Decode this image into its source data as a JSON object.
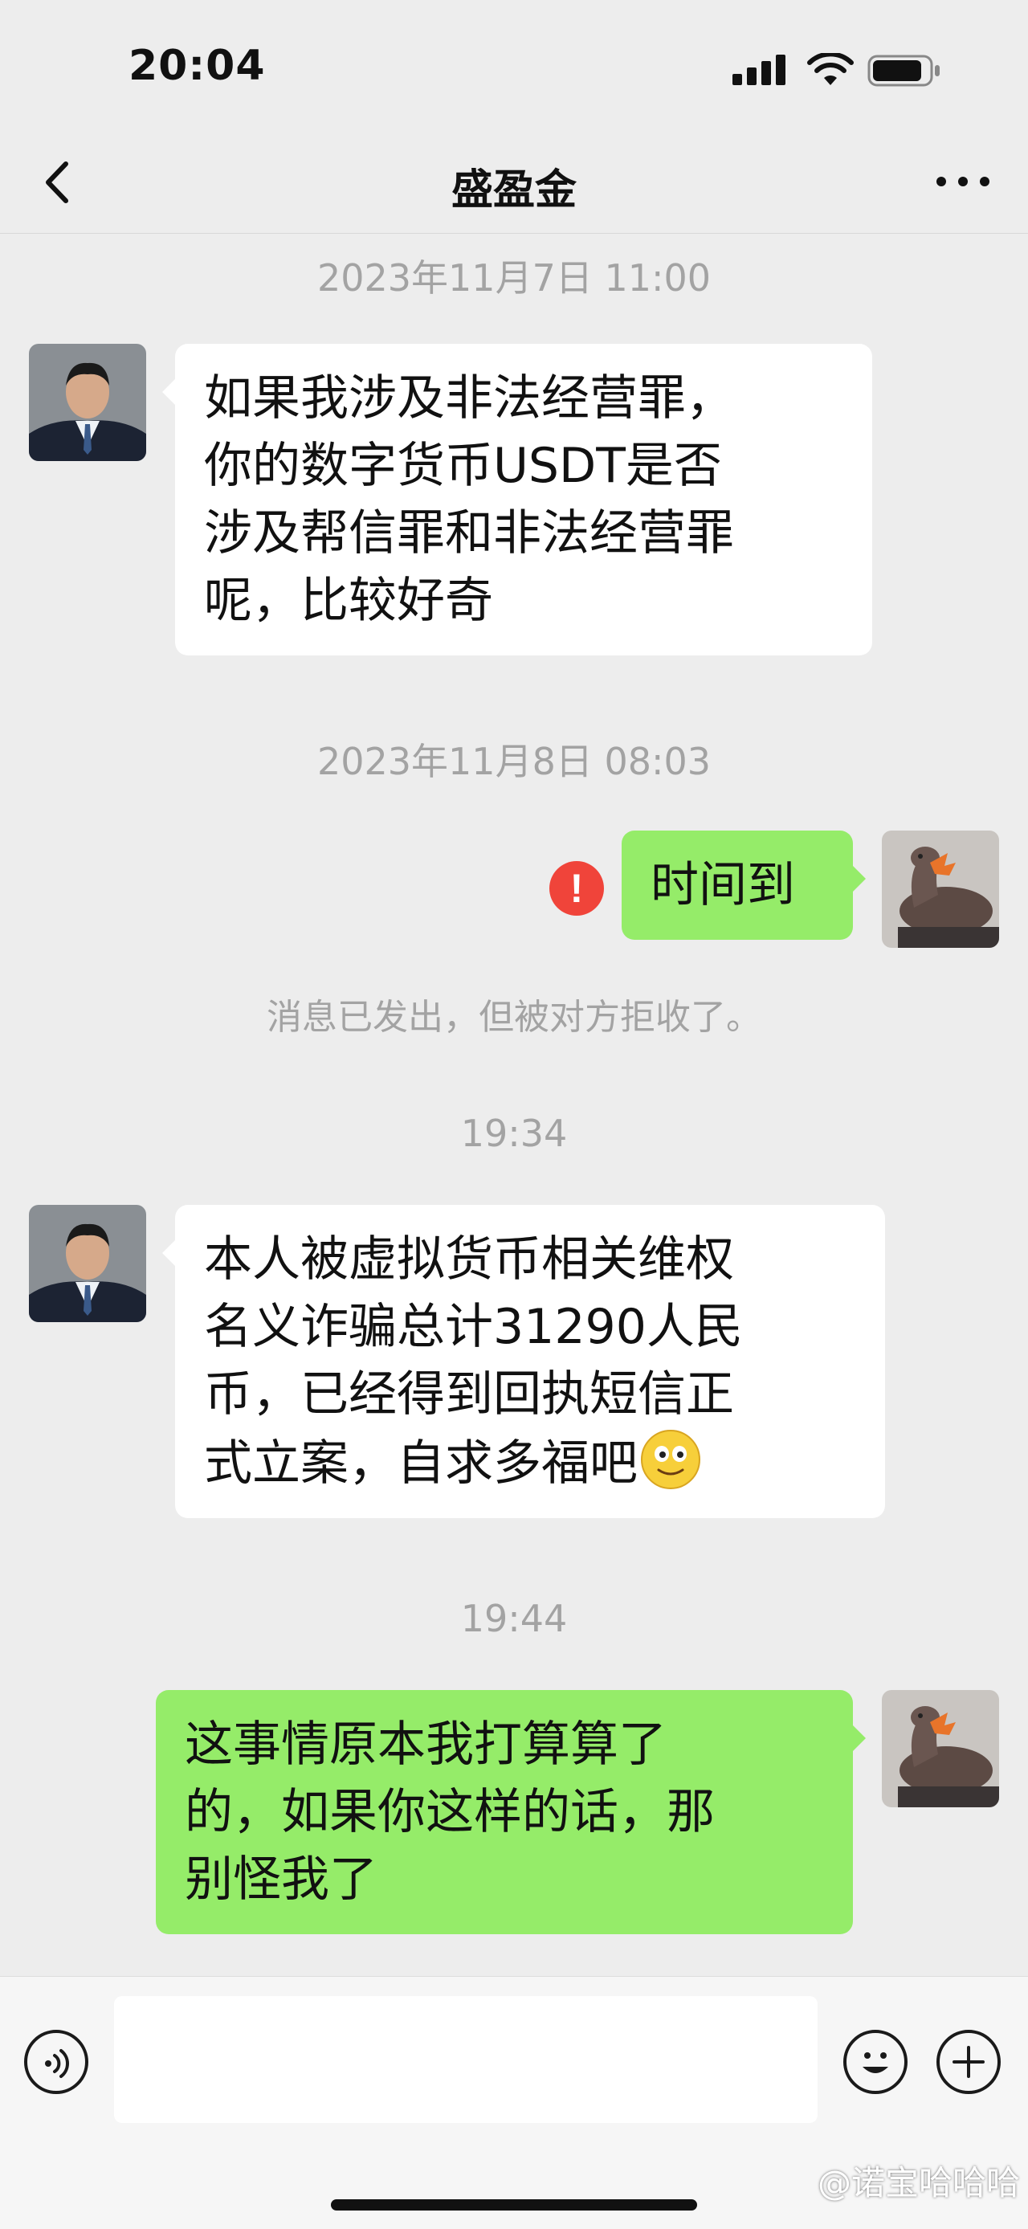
{
  "status_bar": {
    "time": "20:04",
    "icons": [
      "signal-icon",
      "wifi-icon",
      "battery-icon"
    ]
  },
  "nav": {
    "title": "盛盈金",
    "back_icon": "chevron-left-icon",
    "more_icon": "more-icon"
  },
  "messages": [
    {
      "type": "timestamp",
      "text": "2023年11月7日 11:00"
    },
    {
      "type": "received",
      "lines": [
        "如果我涉及非法经营罪，",
        "你的数字货币USDT是否",
        "涉及帮信罪和非法经营罪",
        "呢，比较好奇"
      ]
    },
    {
      "type": "timestamp",
      "text": "2023年11月8日 08:03"
    },
    {
      "type": "sent",
      "lines": [
        "时间到"
      ],
      "failed": true,
      "error_glyph": "!"
    },
    {
      "type": "notice",
      "text": "消息已发出，但被对方拒收了。"
    },
    {
      "type": "timestamp",
      "text": "19:34"
    },
    {
      "type": "received",
      "lines": [
        "本人被虚拟货币相关维权",
        "名义诈骗总计31290人民",
        "币，已经得到回执短信正",
        "式立案，自求多福吧"
      ],
      "emoji": "smile-emoji-icon"
    },
    {
      "type": "timestamp",
      "text": "19:44"
    },
    {
      "type": "sent",
      "lines": [
        "这事情原本我打算算了",
        "的，如果你这样的话，那",
        "别怪我了"
      ]
    }
  ],
  "input_bar": {
    "placeholder": "",
    "icons": [
      "voice-icon",
      "emoji-icon",
      "plus-icon"
    ]
  },
  "watermark": "@诺宝哈哈哈",
  "colors": {
    "background": "#ededed",
    "sent_bubble": "#95ec69",
    "received_bubble": "#ffffff",
    "error": "#f0443a"
  }
}
